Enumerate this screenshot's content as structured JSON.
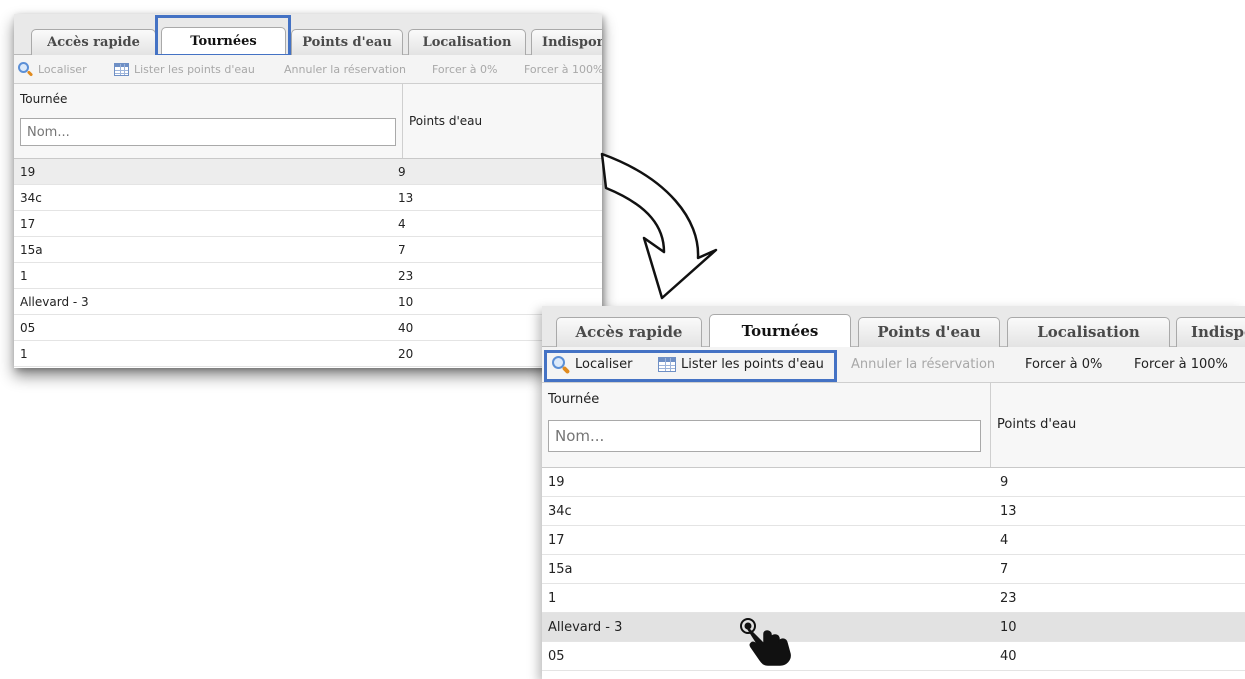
{
  "tabs": [
    "Accès rapide",
    "Tournées",
    "Points d'eau",
    "Localisation",
    "Indisponibilités"
  ],
  "active_tab": "Tournées",
  "toolbar": {
    "localiser": "Localiser",
    "lister": "Lister les points d'eau",
    "annuler": "Annuler la réservation",
    "forcer0": "Forcer à 0%",
    "forcer100": "Forcer à 100%"
  },
  "table": {
    "col_tournee": "Tournée",
    "col_points": "Points d'eau",
    "filter_placeholder": "Nom...",
    "rows": [
      {
        "name": "19",
        "points": "9"
      },
      {
        "name": "34c",
        "points": "13"
      },
      {
        "name": "17",
        "points": "4"
      },
      {
        "name": "15a",
        "points": "7"
      },
      {
        "name": "1",
        "points": "23"
      },
      {
        "name": "Allevard - 3",
        "points": "10"
      },
      {
        "name": "05",
        "points": "40"
      },
      {
        "name": "1",
        "points": "20"
      }
    ]
  },
  "colors": {
    "highlight": "#4472c4"
  }
}
